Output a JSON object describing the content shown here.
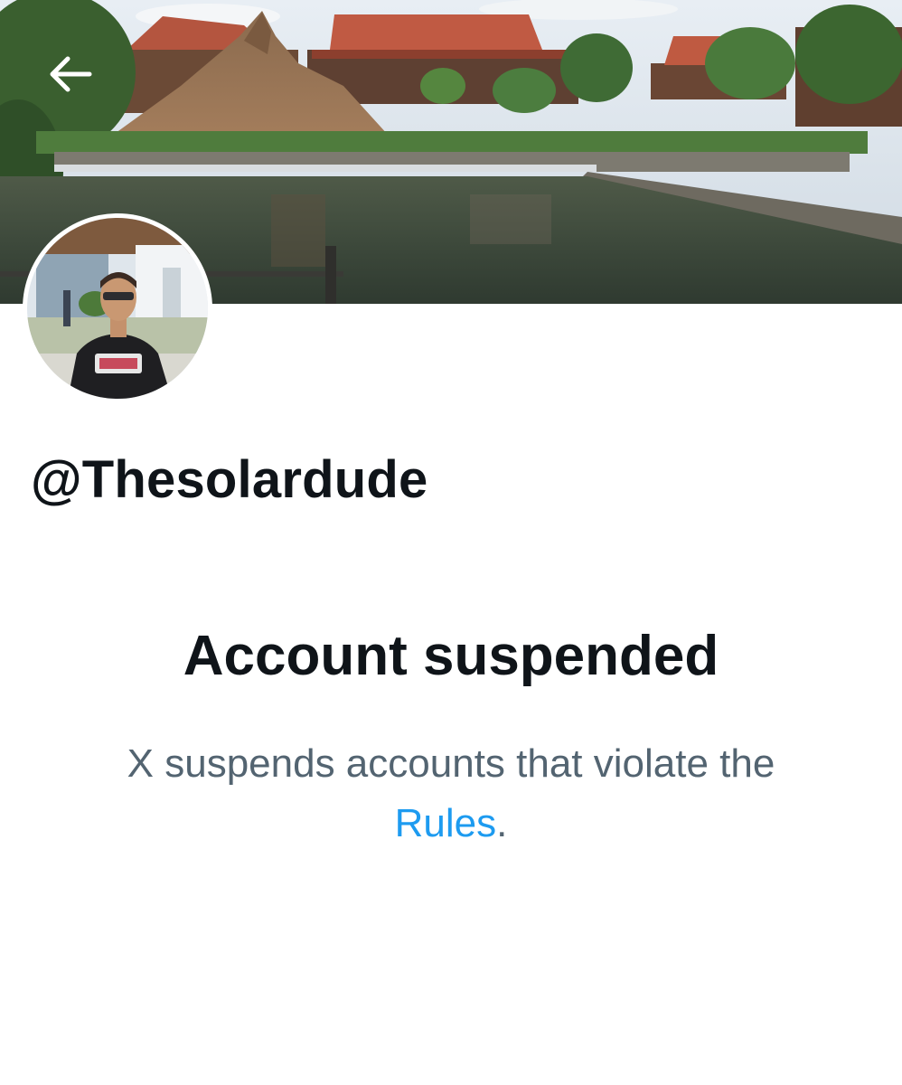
{
  "header": {
    "back_icon": "arrow-left-icon",
    "banner_image": "resort lagoon with volcano and hut-roofed buildings"
  },
  "profile": {
    "avatar_image": "person in black t-shirt outdoors",
    "handle": "@Thesolardude"
  },
  "suspension": {
    "title": "Account suspended",
    "body_text": "X suspends accounts that violate the",
    "link_text": "Rules",
    "trailing_punctuation": ".",
    "link_color": "#1d9bf0",
    "text_color": "#536471"
  }
}
